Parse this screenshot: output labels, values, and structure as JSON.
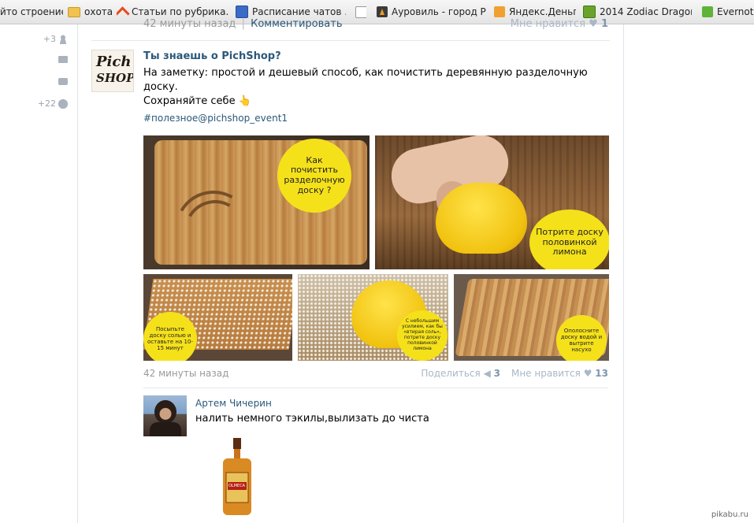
{
  "bookmarks": [
    {
      "label": "йто строение",
      "icon": "none"
    },
    {
      "label": "охота",
      "icon": "folder-icon"
    },
    {
      "label": "Статьи по рубрика...",
      "icon": "caret-icon"
    },
    {
      "label": "Расписание чатов ...",
      "icon": "shield-icon"
    },
    {
      "label": "",
      "icon": "page-icon"
    },
    {
      "label": "Ауровиль - город Р...",
      "icon": "auroville-icon"
    },
    {
      "label": "Яндекс.Деньги",
      "icon": "yandex-money-icon"
    },
    {
      "label": "2014 Zodiac Dragon...",
      "icon": "green-square-icon"
    },
    {
      "label": "Evernote",
      "icon": "evernote-icon"
    }
  ],
  "left_rail": {
    "friends_count": "+3",
    "settings_count": "+22"
  },
  "top_post_meta": {
    "time": "42 минуты назад",
    "separator": "|",
    "comment_link": "Комментировать",
    "like_label": "Мне нравится",
    "like_count": "1"
  },
  "post": {
    "avatar_line1": "Pich",
    "avatar_line2": "SHOP",
    "author": "Ты знаешь о PichShop?",
    "text_line1": "На заметку: простой и дешевый способ, как почистить деревянную разделочную доску.",
    "text_line2": "Сохраняйте себе 👆",
    "hashtag": "#полезное@pichshop_event1",
    "photo_captions": [
      "Как почистить разделочную доску ?",
      "Потрите доску половинкой лимона",
      "Посыпьте доску солью и оставьте на 10-15 минут",
      "С небольшим усилием, как бы «втирая соль», потрите доску половинкой лимона",
      "Ополосните доску водой и вытрите насухо"
    ],
    "time": "42 минуты назад",
    "share_label": "Поделиться",
    "share_count": "3",
    "like_label": "Мне нравится",
    "like_count": "13"
  },
  "comment": {
    "author": "Артем Чичерин",
    "text": "налить немного тэкилы,вылизать до чиста",
    "image_label": "OLMECA"
  },
  "watermark": "pikabu.ru"
}
